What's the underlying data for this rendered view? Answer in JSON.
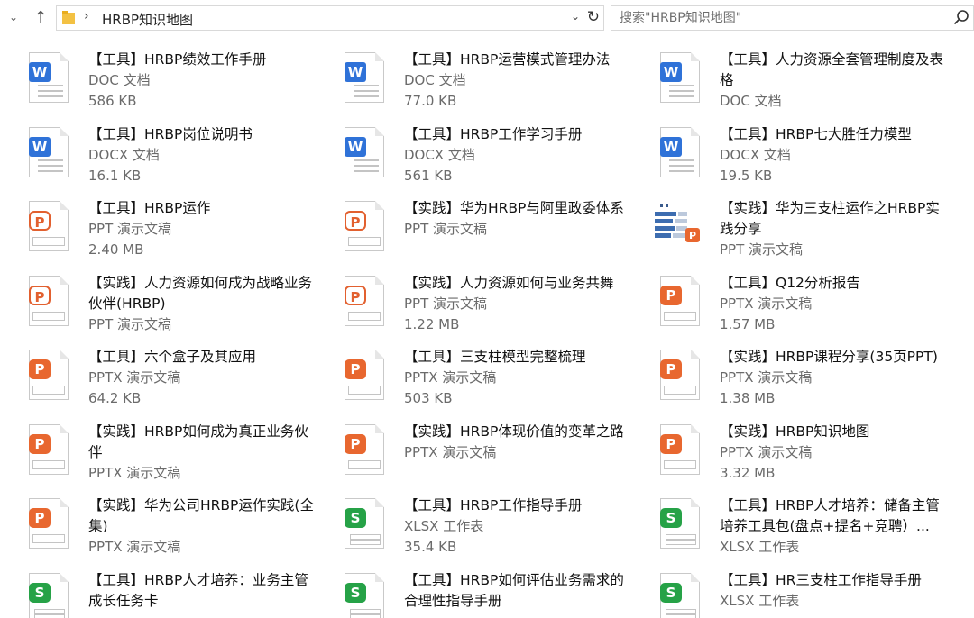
{
  "window": {
    "path": "HRBP知识地图",
    "search_placeholder": "搜索\"HRBP知识地图\""
  },
  "icons": {
    "back": "chevron-down-icon",
    "up": "arrow-up-icon",
    "folder": "folder-icon",
    "refresh": "refresh-icon",
    "search": "search-icon"
  },
  "colors": {
    "word": "#2f72d8",
    "ppt": "#e8672f",
    "xls": "#26a247"
  },
  "files": [
    {
      "name": "【工具】HRBP绩效工作手册",
      "type": "DOC 文档",
      "size": "586 KB",
      "icon": "word"
    },
    {
      "name": "【工具】HRBP运营模式管理办法",
      "type": "DOC 文档",
      "size": "77.0 KB",
      "icon": "word"
    },
    {
      "name": "【工具】人力资源全套管理制度及表格",
      "type": "DOC 文档",
      "size": "",
      "icon": "word"
    },
    {
      "name": "【工具】HRBP岗位说明书",
      "type": "DOCX 文档",
      "size": "16.1 KB",
      "icon": "word"
    },
    {
      "name": "【工具】HRBP工作学习手册",
      "type": "DOCX 文档",
      "size": "561 KB",
      "icon": "word"
    },
    {
      "name": "【工具】HRBP七大胜任力模型",
      "type": "DOCX 文档",
      "size": "19.5 KB",
      "icon": "word"
    },
    {
      "name": "【工具】HRBP运作",
      "type": "PPT 演示文稿",
      "size": "2.40 MB",
      "icon": "ppt-old"
    },
    {
      "name": "【实践】华为HRBP与阿里政委体系",
      "type": "PPT 演示文稿",
      "size": "",
      "icon": "ppt-old"
    },
    {
      "name": "【实践】华为三支柱运作之HRBP实践分享",
      "type": "PPT 演示文稿",
      "size": "",
      "icon": "ppt-thumb"
    },
    {
      "name": "【实践】人力资源如何成为战略业务伙伴(HRBP)",
      "type": "PPT 演示文稿",
      "size": "",
      "icon": "ppt-old"
    },
    {
      "name": "【实践】人力资源如何与业务共舞",
      "type": "PPT 演示文稿",
      "size": "1.22 MB",
      "icon": "ppt-old"
    },
    {
      "name": "【工具】Q12分析报告",
      "type": "PPTX 演示文稿",
      "size": "1.57 MB",
      "icon": "ppt"
    },
    {
      "name": "【工具】六个盒子及其应用",
      "type": "PPTX 演示文稿",
      "size": "64.2 KB",
      "icon": "ppt"
    },
    {
      "name": "【工具】三支柱模型完整梳理",
      "type": "PPTX 演示文稿",
      "size": "503 KB",
      "icon": "ppt"
    },
    {
      "name": "【实践】HRBP课程分享(35页PPT)",
      "type": "PPTX 演示文稿",
      "size": "1.38 MB",
      "icon": "ppt"
    },
    {
      "name": "【实践】HRBP如何成为真正业务伙伴",
      "type": "PPTX 演示文稿",
      "size": "",
      "icon": "ppt"
    },
    {
      "name": "【实践】HRBP体现价值的变革之路",
      "type": "PPTX 演示文稿",
      "size": "",
      "icon": "ppt"
    },
    {
      "name": "【实践】HRBP知识地图",
      "type": "PPTX 演示文稿",
      "size": "3.32 MB",
      "icon": "ppt"
    },
    {
      "name": "【实践】华为公司HRBP运作实践(全集)",
      "type": "PPTX 演示文稿",
      "size": "",
      "icon": "ppt"
    },
    {
      "name": "【工具】HRBP工作指导手册",
      "type": "XLSX 工作表",
      "size": "35.4 KB",
      "icon": "xls"
    },
    {
      "name": "【工具】HRBP人才培养：储备主管培养工具包(盘点+提名+竞聘）...",
      "type": "XLSX 工作表",
      "size": "",
      "icon": "xls"
    },
    {
      "name": "【工具】HRBP人才培养：业务主管成长任务卡",
      "type": "",
      "size": "",
      "icon": "xls"
    },
    {
      "name": "【工具】HRBP如何评估业务需求的合理性指导手册",
      "type": "",
      "size": "",
      "icon": "xls"
    },
    {
      "name": "【工具】HR三支柱工作指导手册",
      "type": "XLSX 工作表",
      "size": "",
      "icon": "xls"
    }
  ]
}
